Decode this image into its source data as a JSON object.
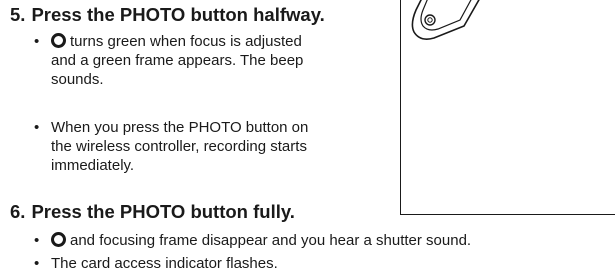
{
  "steps": [
    {
      "number": "5.",
      "title": "Press the PHOTO button halfway.",
      "bullets": [
        {
          "lines": [
            "turns green when focus is adjusted",
            "and a green frame appears. The beep",
            "sounds."
          ]
        },
        {
          "lines": [
            "When you press the PHOTO button on",
            "the wireless controller, recording starts",
            "immediately."
          ]
        }
      ]
    },
    {
      "number": "6.",
      "title": "Press the PHOTO button fully.",
      "bullets": [
        {
          "lines": [
            "and focusing frame disappear and you hear a shutter sound."
          ]
        },
        {
          "lines": [
            "The card access indicator flashes."
          ]
        }
      ]
    }
  ],
  "bullet_glyph": "•",
  "icons": {
    "focus": "focus-circle-icon"
  }
}
